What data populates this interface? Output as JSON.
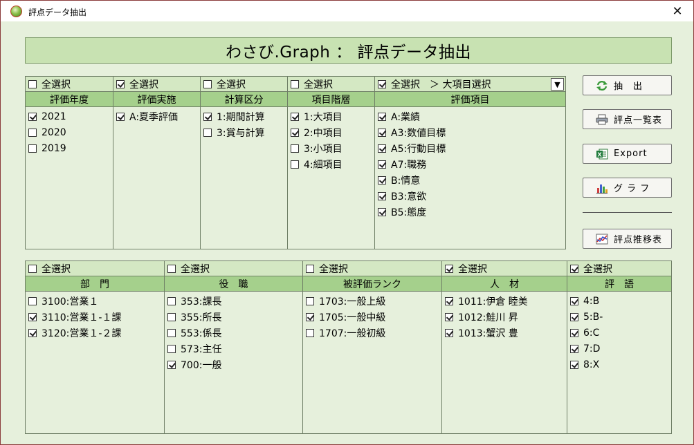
{
  "window": {
    "title": "評点データ抽出",
    "close_glyph": "✕"
  },
  "main_title": "わさび.Graph ： 評点データ抽出",
  "top_panel": {
    "columns": [
      {
        "select_all": "全選択",
        "select_all_checked": false,
        "title": "評価年度",
        "items": [
          {
            "label": "2021",
            "checked": true
          },
          {
            "label": "2020",
            "checked": false
          },
          {
            "label": "2019",
            "checked": false
          }
        ]
      },
      {
        "select_all": "全選択",
        "select_all_checked": true,
        "title": "評価実施",
        "items": [
          {
            "label": "A:夏季評価",
            "checked": true
          }
        ]
      },
      {
        "select_all": "全選択",
        "select_all_checked": false,
        "title": "計算区分",
        "items": [
          {
            "label": "1:期間計算",
            "checked": true
          },
          {
            "label": "3:賞与計算",
            "checked": false
          }
        ]
      },
      {
        "select_all": "全選択",
        "select_all_checked": false,
        "title": "項目階層",
        "items": [
          {
            "label": "1:大項目",
            "checked": true
          },
          {
            "label": "2:中項目",
            "checked": true
          },
          {
            "label": "3:小項目",
            "checked": false
          },
          {
            "label": "4:細項目",
            "checked": false
          }
        ]
      },
      {
        "select_all": "全選択",
        "select_all_checked": true,
        "extra_label": "＞ 大項目選択",
        "dropdown_glyph": "▼",
        "title": "評価項目",
        "items": [
          {
            "label": "A:業績",
            "checked": true
          },
          {
            "label": "A3:数値目標",
            "checked": true
          },
          {
            "label": "A5:行動目標",
            "checked": true
          },
          {
            "label": "A7:職務",
            "checked": true
          },
          {
            "label": "B:情意",
            "checked": true
          },
          {
            "label": "B3:意欲",
            "checked": true
          },
          {
            "label": "B5:態度",
            "checked": true
          }
        ]
      }
    ]
  },
  "bottom_panel": {
    "columns": [
      {
        "select_all": "全選択",
        "select_all_checked": false,
        "title": "部　門",
        "items": [
          {
            "label": "3100:営業１",
            "checked": false
          },
          {
            "label": "3110:営業１-１課",
            "checked": true
          },
          {
            "label": "3120:営業１-２課",
            "checked": true
          }
        ]
      },
      {
        "select_all": "全選択",
        "select_all_checked": false,
        "title": "役　職",
        "items": [
          {
            "label": "353:課長",
            "checked": false
          },
          {
            "label": "355:所長",
            "checked": false
          },
          {
            "label": "553:係長",
            "checked": false
          },
          {
            "label": "573:主任",
            "checked": false
          },
          {
            "label": "700:一般",
            "checked": true
          }
        ]
      },
      {
        "select_all": "全選択",
        "select_all_checked": false,
        "title": "被評価ランク",
        "items": [
          {
            "label": "1703:一般上級",
            "checked": false
          },
          {
            "label": "1705:一般中級",
            "checked": true
          },
          {
            "label": "1707:一般初級",
            "checked": false
          }
        ]
      },
      {
        "select_all": "全選択",
        "select_all_checked": true,
        "title": "人　材",
        "items": [
          {
            "label": "1011:伊倉 睦美",
            "checked": true
          },
          {
            "label": "1012:鮭川 昇",
            "checked": true
          },
          {
            "label": "1013:蟹沢 豊",
            "checked": true
          }
        ]
      },
      {
        "select_all": "全選択",
        "select_all_checked": true,
        "title": "評　語",
        "items": [
          {
            "label": "4:B",
            "checked": true
          },
          {
            "label": "5:B-",
            "checked": true
          },
          {
            "label": "6:C",
            "checked": true
          },
          {
            "label": "7:D",
            "checked": true
          },
          {
            "label": "8:X",
            "checked": true
          }
        ]
      }
    ]
  },
  "buttons": {
    "extract": "抽　出",
    "score_list": "評点一覧表",
    "export": "Export",
    "graph": "グ ラ フ",
    "trend": "評点推移表"
  },
  "icons": {
    "extract": "recycle-arrows-icon",
    "score_list": "printer-icon",
    "export": "excel-export-icon",
    "graph": "bar-chart-icon",
    "trend": "line-chart-icon"
  }
}
